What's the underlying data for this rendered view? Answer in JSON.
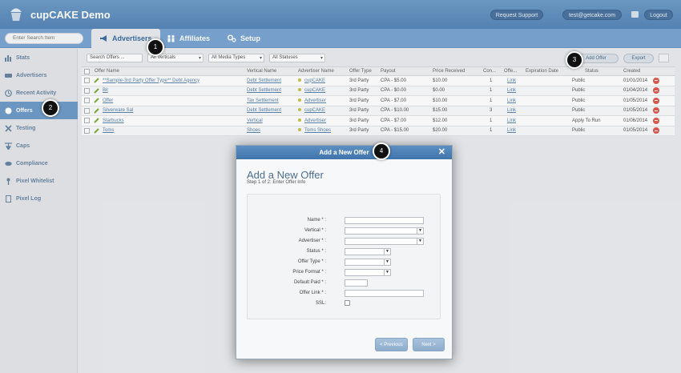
{
  "header": {
    "app_title": "cupCAKE Demo",
    "request_support": "Request Support",
    "user_email": "test@getcake.com",
    "logout": "Logout"
  },
  "nav": {
    "search_placeholder": "Enter Search Item",
    "tabs": [
      {
        "label": "Advertisers",
        "icon": "megaphone-icon"
      },
      {
        "label": "Affiliates",
        "icon": "people-icon"
      },
      {
        "label": "Setup",
        "icon": "gears-icon"
      }
    ]
  },
  "sidebar": {
    "items": [
      {
        "label": "Stats",
        "icon": "bar-chart-icon"
      },
      {
        "label": "Advertisers",
        "icon": "megaphone-icon"
      },
      {
        "label": "Recent Activity",
        "icon": "clock-icon"
      },
      {
        "label": "Offers",
        "icon": "offer-icon",
        "active": true
      },
      {
        "label": "Testing",
        "icon": "tools-icon"
      },
      {
        "label": "Caps",
        "icon": "cap-icon"
      },
      {
        "label": "Compliance",
        "icon": "compliance-icon"
      },
      {
        "label": "Pixel Whitelist",
        "icon": "pixel-icon"
      },
      {
        "label": "Pixel Log",
        "icon": "document-icon"
      }
    ]
  },
  "toolbar": {
    "search_placeholder": "Search Offers ...",
    "verticals_filter": "All Verticals",
    "media_types_filter": "All Media Types",
    "statuses_filter": "All Statuses",
    "add_offer": "Add Offer",
    "export": "Export"
  },
  "table": {
    "columns": [
      "Offer Name",
      "Vertical Name",
      "Advertiser Name",
      "Offer Type",
      "Payout",
      "Price Received",
      "Con...",
      "Offe...",
      "Expiration Date",
      "Status",
      "Created"
    ],
    "rows": [
      {
        "offer": "**Sample-3rd Party Offer Type** Debt Agency",
        "vertical": "Debt Settlement",
        "advertiser": "cupCAKE",
        "type": "3rd Party",
        "payout": "CPA - $5.00",
        "price": "$10.00",
        "con": "1",
        "link": "Link",
        "expiration": "",
        "status": "Public",
        "created": "01/01/2014"
      },
      {
        "offer": "Bil",
        "vertical": "Debt Settlement",
        "advertiser": "cupCAKE",
        "type": "3rd Party",
        "payout": "CPA - $0.00",
        "price": "$0.00",
        "con": "1",
        "link": "Link",
        "expiration": "",
        "status": "Public",
        "created": "01/04/2014"
      },
      {
        "offer": "Offer",
        "vertical": "Tax Settlement",
        "advertiser": "Advertiser",
        "type": "3rd Party",
        "payout": "CPA - $7.00",
        "price": "$10.00",
        "con": "1",
        "link": "Link",
        "expiration": "",
        "status": "Public",
        "created": "01/05/2014"
      },
      {
        "offer": "Silverware Sal",
        "vertical": "Debt Settlement",
        "advertiser": "cupCAKE",
        "type": "3rd Party",
        "payout": "CPA - $10.00",
        "price": "$15.00",
        "con": "3",
        "link": "Link",
        "expiration": "",
        "status": "Public",
        "created": "01/05/2014"
      },
      {
        "offer": "Starbucks",
        "vertical": "Vertical",
        "advertiser": "Advertiser",
        "type": "3rd Party",
        "payout": "CPA - $7.00",
        "price": "$12.00",
        "con": "1",
        "link": "Link",
        "expiration": "",
        "status": "Apply To Run",
        "created": "01/06/2014"
      },
      {
        "offer": "Toms",
        "vertical": "Shoes",
        "advertiser": "Toms Shoes",
        "type": "3rd Party",
        "payout": "CPA - $15.00",
        "price": "$20.00",
        "con": "1",
        "link": "Link",
        "expiration": "",
        "status": "Public",
        "created": "01/05/2014"
      }
    ]
  },
  "modal": {
    "header": "Add a New Offer",
    "title": "Add a New Offer",
    "subtitle": "Step 1 of 2: Enter Offer Info",
    "fields": {
      "name": "Name * :",
      "vertical": "Vertical * :",
      "advertiser": "Advertiser * :",
      "status": "Status * :",
      "offer_type": "Offer Type * :",
      "price_format": "Price Format * :",
      "default_paid": "Default Paid * :",
      "offer_link": "Offer Link * :",
      "ssl": "SSL:"
    },
    "previous": "< Previous",
    "next": "Next >"
  },
  "callouts": [
    "1",
    "2",
    "3",
    "4"
  ],
  "colors": {
    "header_blue": "#5686b7",
    "nav_blue": "#7aa6d2",
    "active_sidebar": "#6f9bc8",
    "modal_header": "#3f74ab",
    "delete_red": "#e05a4f"
  }
}
